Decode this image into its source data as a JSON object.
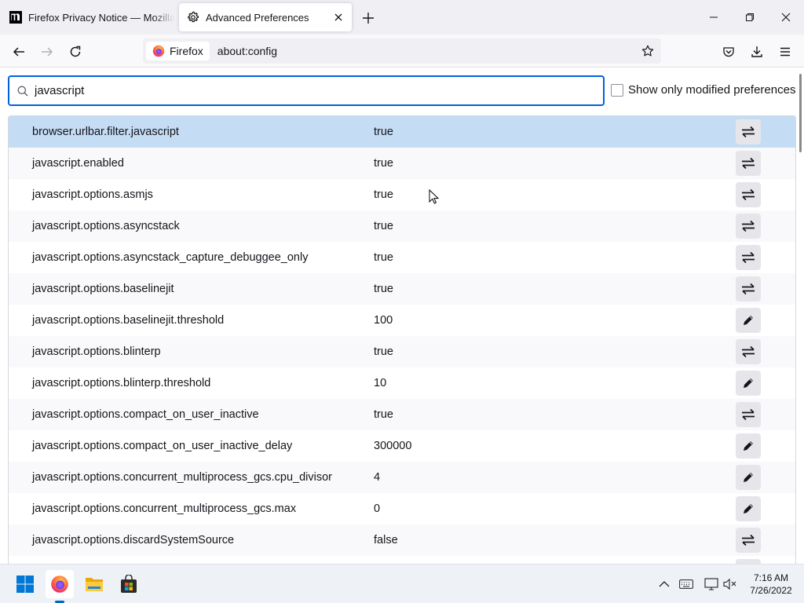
{
  "browser": {
    "tabs": [
      {
        "title": "Firefox Privacy Notice — Mozilla",
        "icon": "mozilla-m-icon",
        "active": false
      },
      {
        "title": "Advanced Preferences",
        "icon": "gear-icon",
        "active": true
      }
    ],
    "identity_label": "Firefox",
    "url": "about:config"
  },
  "config": {
    "search_value": "javascript",
    "show_modified_label": "Show only modified preferences",
    "preferences": [
      {
        "name": "browser.urlbar.filter.javascript",
        "value": "true",
        "action": "toggle"
      },
      {
        "name": "javascript.enabled",
        "value": "true",
        "action": "toggle"
      },
      {
        "name": "javascript.options.asmjs",
        "value": "true",
        "action": "toggle"
      },
      {
        "name": "javascript.options.asyncstack",
        "value": "true",
        "action": "toggle"
      },
      {
        "name": "javascript.options.asyncstack_capture_debuggee_only",
        "value": "true",
        "action": "toggle"
      },
      {
        "name": "javascript.options.baselinejit",
        "value": "true",
        "action": "toggle"
      },
      {
        "name": "javascript.options.baselinejit.threshold",
        "value": "100",
        "action": "edit"
      },
      {
        "name": "javascript.options.blinterp",
        "value": "true",
        "action": "toggle"
      },
      {
        "name": "javascript.options.blinterp.threshold",
        "value": "10",
        "action": "edit"
      },
      {
        "name": "javascript.options.compact_on_user_inactive",
        "value": "true",
        "action": "toggle"
      },
      {
        "name": "javascript.options.compact_on_user_inactive_delay",
        "value": "300000",
        "action": "edit"
      },
      {
        "name": "javascript.options.concurrent_multiprocess_gcs.cpu_divisor",
        "value": "4",
        "action": "edit"
      },
      {
        "name": "javascript.options.concurrent_multiprocess_gcs.max",
        "value": "0",
        "action": "edit"
      },
      {
        "name": "javascript.options.discardSystemSource",
        "value": "false",
        "action": "toggle"
      },
      {
        "name": "",
        "value": "",
        "action": "toggle"
      }
    ]
  },
  "taskbar": {
    "time": "7:16 AM",
    "date": "7/26/2022"
  },
  "colors": {
    "accent": "#0061e0",
    "selected_row": "#c4dcf4"
  }
}
